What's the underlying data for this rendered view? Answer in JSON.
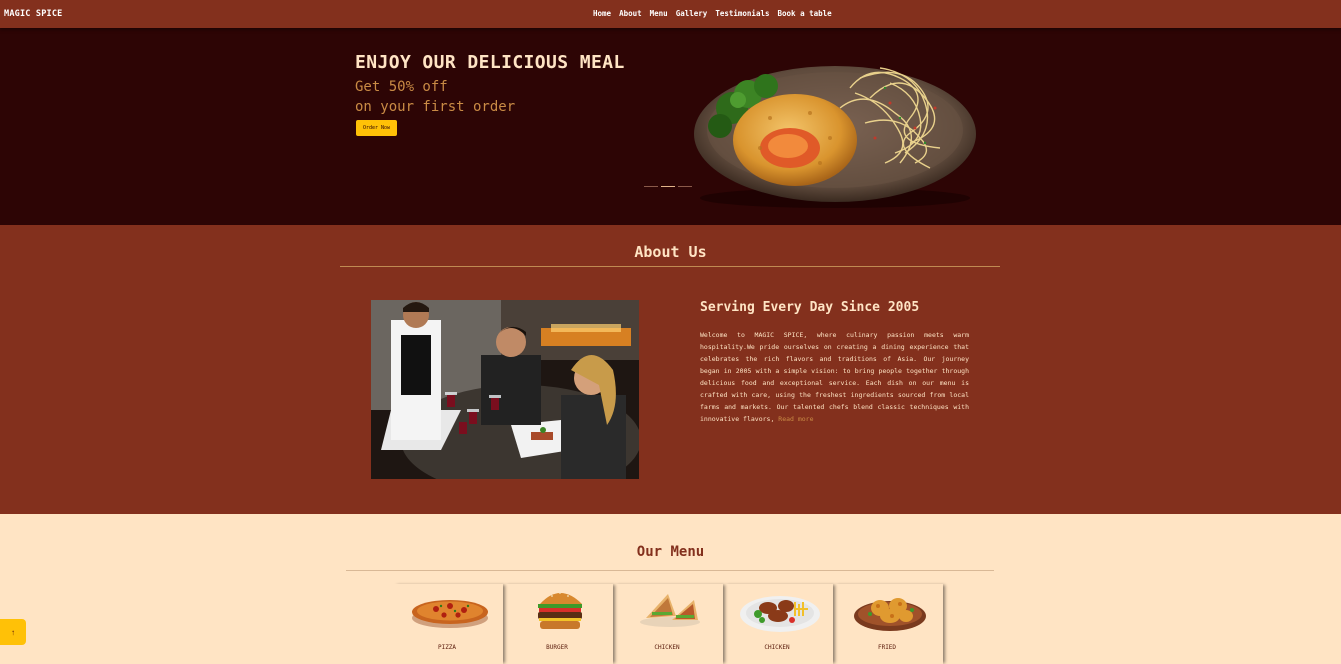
{
  "navbar": {
    "brand": "MAGIC SPICE",
    "links": [
      "Home",
      "About",
      "Menu",
      "Gallery",
      "Testimonials",
      "Book a table"
    ]
  },
  "hero": {
    "title": "ENJOY OUR DELICIOUS MEAL",
    "subtitle_line1": "Get 50% off",
    "subtitle_line2": "on your first order",
    "cta_label": "Order Now",
    "slide_count": 3,
    "active_slide": 1
  },
  "about": {
    "title": "About Us",
    "heading": "Serving Every Day Since 2005",
    "text": "Welcome to MAGIC SPICE, where culinary passion meets warm hospitality.We pride ourselves on creating a dining experience that celebrates the rich flavors and traditions of Asia. Our journey began in 2005 with a simple vision: to bring people together through delicious food and exceptional service. Each dish on our menu is crafted with care, using the freshest ingredients sourced from local farms and markets. Our talented chefs blend classic techniques with innovative flavors,",
    "read_more": "Read more"
  },
  "menu": {
    "title": "Our Menu",
    "items": [
      {
        "label": "PIZZA",
        "icon": "pizza-icon"
      },
      {
        "label": "BURGER",
        "icon": "burger-icon"
      },
      {
        "label": "CHICKEN",
        "icon": "sandwich-icon"
      },
      {
        "label": "CHICKEN",
        "icon": "chicken-platter-icon"
      },
      {
        "label": "FRIED",
        "icon": "fried-chicken-icon"
      }
    ]
  },
  "back_to_top": {
    "icon": "arrow-up-icon",
    "glyph": "↑"
  },
  "colors": {
    "nav_bg": "#83301d",
    "hero_bg": "#2d0505",
    "about_bg": "#83301d",
    "menu_bg": "#ffe4c4",
    "accent": "#ffc107",
    "text_light": "#ffe4c4",
    "text_tan": "#c98b45"
  }
}
